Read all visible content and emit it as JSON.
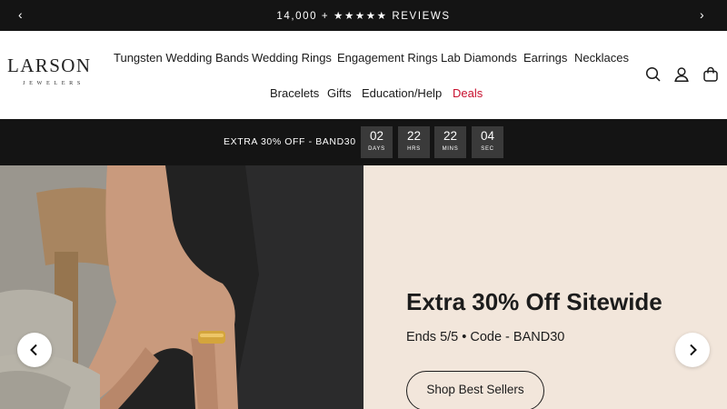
{
  "announcement": {
    "text": "14,000 + ★★★★★ REVIEWS",
    "prev_icon": "chevron-left-icon",
    "next_icon": "chevron-right-icon",
    "prev_glyph": "‹",
    "next_glyph": "›"
  },
  "brand": {
    "name": "LARSON",
    "tagline": "JEWELERS"
  },
  "nav": {
    "row1": [
      "Tungsten Wedding Bands",
      "Wedding Rings",
      "Engagement Rings",
      "Lab Diamonds",
      "Earrings",
      "Necklaces"
    ],
    "row2": [
      "Bracelets",
      "Gifts",
      "Education/Help",
      "Deals"
    ],
    "deals_color": "#c8102e"
  },
  "header_icons": [
    "search-icon",
    "account-icon",
    "cart-icon"
  ],
  "promo": {
    "label": "EXTRA 30% OFF - BAND30",
    "countdown": [
      {
        "value": "02",
        "unit": "DAYS"
      },
      {
        "value": "22",
        "unit": "HRS"
      },
      {
        "value": "22",
        "unit": "MINS"
      },
      {
        "value": "04",
        "unit": "SEC"
      }
    ]
  },
  "hero": {
    "headline": "Extra 30% Off Sitewide",
    "subline": "Ends 5/5 • Code - BAND30",
    "cta": "Shop Best Sellers",
    "panel_color": "#f2e6db",
    "prev_icon": "chevron-left-icon",
    "next_icon": "chevron-right-icon"
  },
  "colors": {
    "bar_background": "#141414",
    "countdown_box": "#3a3a3a"
  }
}
